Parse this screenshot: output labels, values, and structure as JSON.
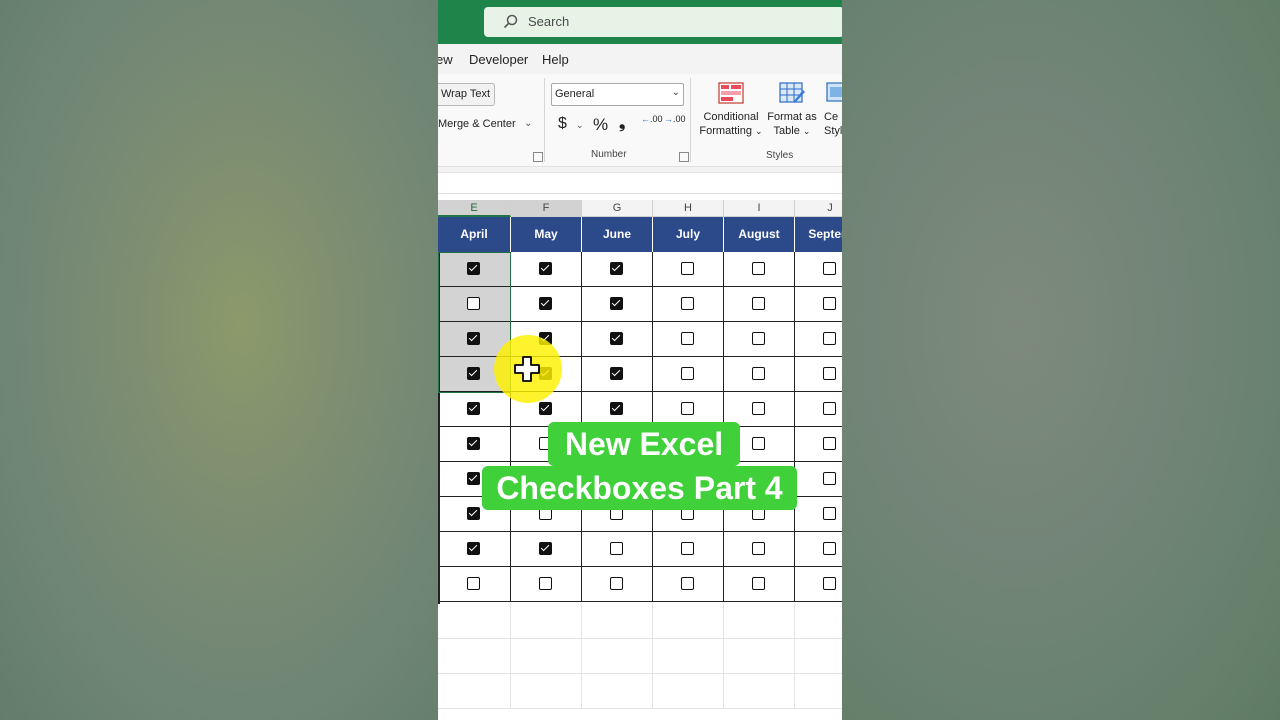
{
  "search": {
    "label": "Search"
  },
  "menu": [
    "ew",
    "Developer",
    "Help"
  ],
  "ribbon": {
    "wrap_text": "Wrap Text",
    "merge_center": "Merge & Center",
    "number_format": "General",
    "number_group_label": "Number",
    "currency_symbol": "$",
    "percent_symbol": "%",
    "comma_symbol": "❟",
    "increase_decimal": ".00",
    "decrease_decimal": ".00",
    "conditional_formatting": [
      "Conditional",
      "Formatting"
    ],
    "format_as_table": [
      "Format as",
      "Table"
    ],
    "cell_styles": [
      "Ce",
      "Style"
    ],
    "styles_group_label": "Styles"
  },
  "columns": [
    "E",
    "F",
    "G",
    "H",
    "I",
    "J"
  ],
  "months": [
    "April",
    "May",
    "June",
    "July",
    "August",
    "Septem"
  ],
  "checkbox_grid": [
    [
      true,
      true,
      true,
      false,
      false,
      false
    ],
    [
      false,
      true,
      true,
      false,
      false,
      false
    ],
    [
      true,
      true,
      true,
      false,
      false,
      false
    ],
    [
      true,
      true,
      true,
      false,
      false,
      false
    ],
    [
      true,
      true,
      true,
      false,
      false,
      false
    ],
    [
      true,
      false,
      false,
      false,
      false,
      false
    ],
    [
      true,
      false,
      false,
      false,
      false,
      false
    ],
    [
      true,
      false,
      false,
      false,
      false,
      false
    ],
    [
      true,
      true,
      false,
      false,
      false,
      false
    ],
    [
      false,
      false,
      false,
      false,
      false,
      false
    ]
  ],
  "banner": {
    "line1": "New Excel",
    "line2": "Checkboxes Part 4"
  },
  "colors": {
    "title_bar": "#1e8449",
    "table_header": "#2c4a8a",
    "banner": "#3fd03a",
    "highlight": "#fff000"
  }
}
